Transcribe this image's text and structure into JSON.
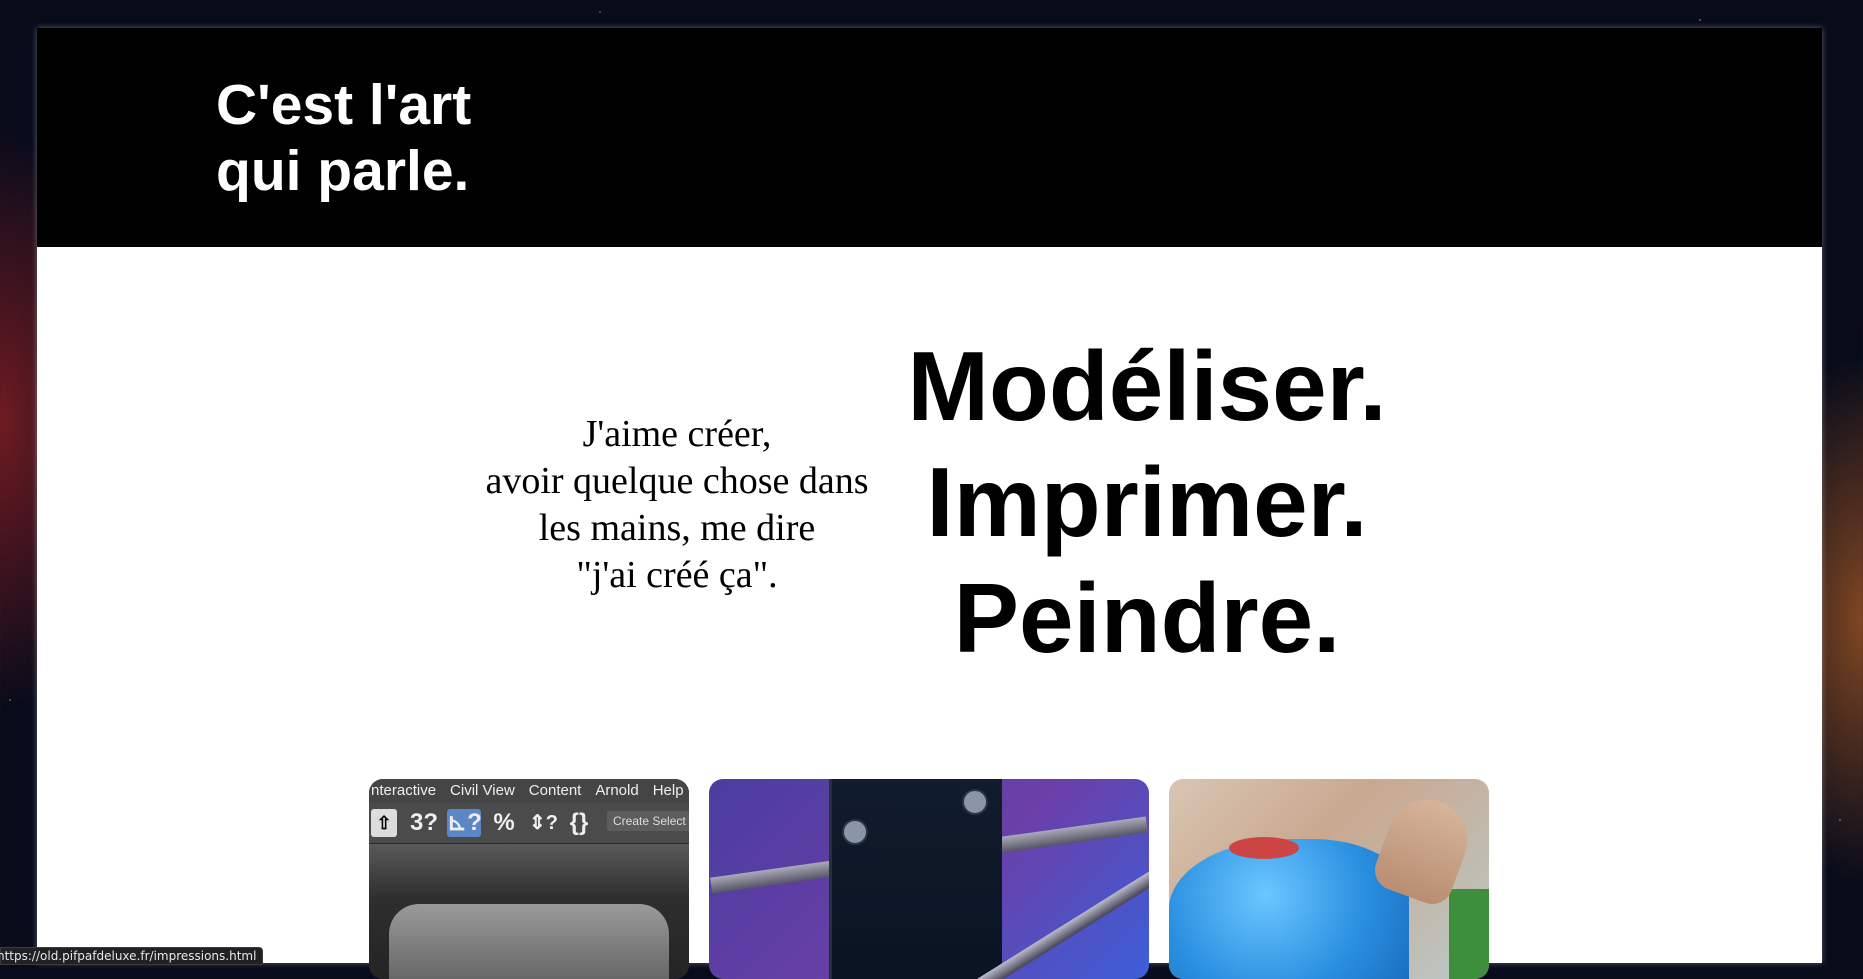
{
  "header": {
    "title_line1": "C'est l'art",
    "title_line2": "qui parle."
  },
  "intro": {
    "lines": [
      "J'aime créer,",
      "avoir quelque chose dans",
      "les mains, me dire",
      "\"j'ai créé ça\"."
    ]
  },
  "verbs": [
    "Modéliser.",
    "Imprimer.",
    "Peindre."
  ],
  "cards": {
    "model": {
      "menu": [
        "nteractive",
        "Civil View",
        "Content",
        "Arnold",
        "Help"
      ],
      "toolbar_icons": [
        "⇧",
        "3?",
        "⊾?",
        "%",
        "⇕?",
        "{}"
      ],
      "toolbar_button": "Create Select"
    }
  },
  "status_url": "https://old.pifpafdeluxe.fr/impressions.html"
}
